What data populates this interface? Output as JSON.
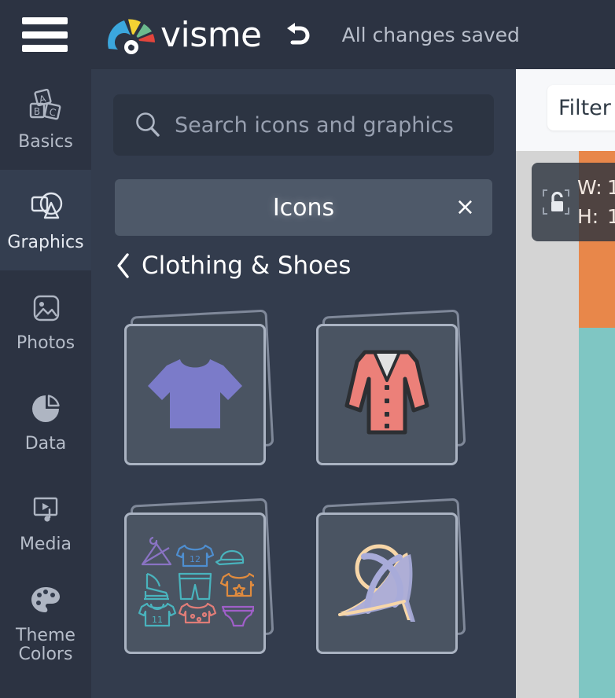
{
  "app": {
    "brand": "visme",
    "save_status": "All changes saved",
    "menu_icon": "hamburger-icon",
    "undo_icon": "undo-icon"
  },
  "sidebar": {
    "items": [
      {
        "id": "basics",
        "label": "Basics",
        "icon": "abc-blocks-icon",
        "active": false
      },
      {
        "id": "graphics",
        "label": "Graphics",
        "icon": "shapes-icon",
        "active": true
      },
      {
        "id": "photos",
        "label": "Photos",
        "icon": "image-icon",
        "active": false
      },
      {
        "id": "data",
        "label": "Data",
        "icon": "pie-chart-icon",
        "active": false
      },
      {
        "id": "media",
        "label": "Media",
        "icon": "media-play-icon",
        "active": false
      },
      {
        "id": "theme_colors",
        "label": "Theme\nColors",
        "icon": "palette-icon",
        "active": false
      }
    ]
  },
  "panel": {
    "search": {
      "placeholder": "Search icons and graphics",
      "value": "",
      "icon": "search-icon"
    },
    "category_pill": {
      "label": "Icons",
      "close_label": "×"
    },
    "breadcrumb": {
      "back_icon": "chevron-left-icon",
      "title": "Clothing & Shoes"
    },
    "results": [
      {
        "id": "tshirt",
        "name": "t-shirt-icon",
        "label": "T-Shirt"
      },
      {
        "id": "cardigan",
        "name": "cardigan-jacket-icon",
        "label": "Cardigan"
      },
      {
        "id": "clothing_set",
        "name": "clothing-icon-set",
        "label": "Clothing Icon Set"
      },
      {
        "id": "high_heel",
        "name": "high-heel-shoe-icon",
        "label": "High Heel Shoe"
      }
    ]
  },
  "canvas": {
    "filter_button": {
      "label": "Filter"
    },
    "size_tooltip": {
      "lock_icon": "unlock-icon",
      "width_key": "W:",
      "width_value": "1",
      "height_key": "H:",
      "height_value": "1"
    }
  },
  "colors": {
    "app_bg": "#2c3342",
    "panel_bg": "#333c4d",
    "sidebar_active": "#343e50",
    "card_front": "#4a5462",
    "pill_bg": "#4e5969",
    "canvas_bg": "#d4d4d4",
    "block_orange": "#e8874a",
    "block_teal": "#7fc6c3",
    "tshirt_purple": "#7b7bc9",
    "cardigan_salmon": "#ec8079",
    "heel_periwinkle": "#a8abd9",
    "heel_peach": "#f7d6a8",
    "logo_blue": "#3ba7dd",
    "logo_yellow": "#f4d233",
    "logo_green": "#6cba8e",
    "logo_red": "#e2453c"
  }
}
